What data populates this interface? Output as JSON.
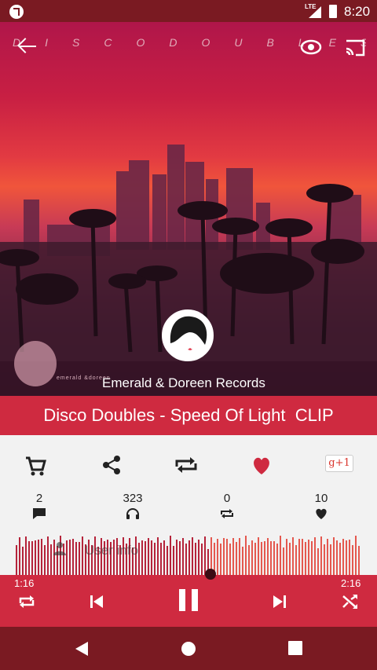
{
  "status_bar": {
    "time": "8:20",
    "network": "LTE"
  },
  "toolbar": {
    "marquee": "DISCODOUBLES",
    "back_icon": "arrow-back-icon",
    "icons": [
      "eye-icon",
      "cast-icon"
    ]
  },
  "record_label": {
    "name": "Emerald & Doreen Records",
    "logo_text": "emerald &doreen"
  },
  "track": {
    "title": "Disco Doubles - Speed Of Light  CLIP"
  },
  "actions": {
    "items": [
      "cart-icon",
      "share-icon",
      "repost-icon",
      "heart-icon"
    ],
    "gplus_label": "g+1"
  },
  "stats": [
    {
      "value": "2",
      "icon": "comment-icon"
    },
    {
      "value": "323",
      "icon": "headphones-icon"
    },
    {
      "value": "0",
      "icon": "repost-icon"
    },
    {
      "value": "10",
      "icon": "heart-icon"
    }
  ],
  "waveform": {
    "overlay_text": "User info",
    "progress": 0.56
  },
  "player": {
    "elapsed": "1:16",
    "duration": "2:16",
    "controls": [
      "repeat-icon",
      "previous-icon",
      "pause-icon",
      "next-icon",
      "shuffle-icon"
    ]
  },
  "colors": {
    "accent": "#cf2a40",
    "dark": "#7a1a22",
    "played": "#b5233a",
    "unplayed": "#e4584f"
  },
  "nav": [
    "back-nav-icon",
    "home-nav-icon",
    "recents-nav-icon"
  ]
}
